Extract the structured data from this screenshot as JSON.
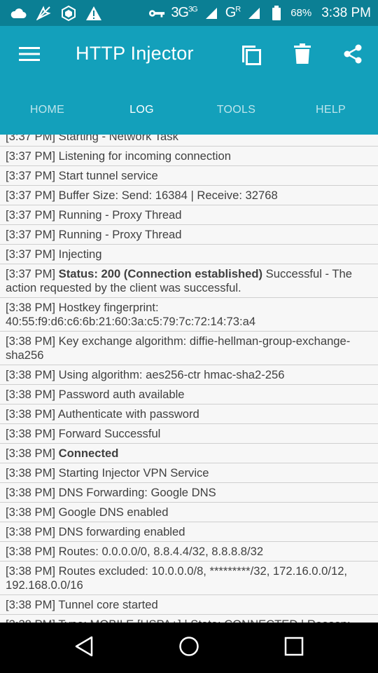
{
  "status_bar": {
    "network": "3G",
    "network_sup": "3G",
    "network2": "G",
    "network2_sup": "R",
    "battery": "68%",
    "time": "3:38 PM",
    "icons": [
      "cloud-icon",
      "no-location-icon",
      "shield-cube-icon",
      "warning-icon",
      "key-icon",
      "battery-icon"
    ]
  },
  "app_bar": {
    "title": "HTTP Injector",
    "icons": [
      "menu-icon",
      "copy-icon",
      "delete-icon",
      "share-icon"
    ]
  },
  "tabs": [
    {
      "label": "HOME",
      "active": false
    },
    {
      "label": "LOG",
      "active": true
    },
    {
      "label": "TOOLS",
      "active": false
    },
    {
      "label": "HELP",
      "active": false
    }
  ],
  "log": [
    {
      "time": "[3:37 PM]",
      "bold": "",
      "text": "Starting - Network Task"
    },
    {
      "time": "[3:37 PM]",
      "bold": "",
      "text": "Listening for incoming connection"
    },
    {
      "time": "[3:37 PM]",
      "bold": "",
      "text": "Start tunnel service"
    },
    {
      "time": "[3:37 PM]",
      "bold": "",
      "text": "Buffer Size: Send: 16384 | Receive: 32768"
    },
    {
      "time": "[3:37 PM]",
      "bold": "",
      "text": "Running - Proxy Thread"
    },
    {
      "time": "[3:37 PM]",
      "bold": "",
      "text": "Running - Proxy Thread"
    },
    {
      "time": "[3:37 PM]",
      "bold": "",
      "text": "Injecting"
    },
    {
      "time": "[3:37 PM]",
      "bold": "Status: 200 (Connection established)",
      "text": "Successful - The action requested by the client was successful."
    },
    {
      "time": "[3:38 PM]",
      "bold": "",
      "text": "Hostkey fingerprint: 40:55:f9:d6:c6:6b:21:60:3a:c5:79:7c:72:14:73:a4"
    },
    {
      "time": "[3:38 PM]",
      "bold": "",
      "text": "Key exchange algorithm: diffie-hellman-group-exchange-sha256"
    },
    {
      "time": "[3:38 PM]",
      "bold": "",
      "text": "Using algorithm: aes256-ctr hmac-sha2-256"
    },
    {
      "time": "[3:38 PM]",
      "bold": "",
      "text": "Password auth available"
    },
    {
      "time": "[3:38 PM]",
      "bold": "",
      "text": "Authenticate with password"
    },
    {
      "time": "[3:38 PM]",
      "bold": "",
      "text": "Forward Successful"
    },
    {
      "time": "[3:38 PM]",
      "bold": "Connected",
      "text": ""
    },
    {
      "time": "[3:38 PM]",
      "bold": "",
      "text": "Starting Injector VPN Service"
    },
    {
      "time": "[3:38 PM]",
      "bold": "",
      "text": "DNS Forwarding: Google DNS"
    },
    {
      "time": "[3:38 PM]",
      "bold": "",
      "text": "Google DNS enabled"
    },
    {
      "time": "[3:38 PM]",
      "bold": "",
      "text": "DNS forwarding enabled"
    },
    {
      "time": "[3:38 PM]",
      "bold": "",
      "text": "Routes: 0.0.0.0/0, 8.8.4.4/32, 8.8.8.8/32"
    },
    {
      "time": "[3:38 PM]",
      "bold": "",
      "text": "Routes excluded: 10.0.0.0/8, *********/32, 172.16.0.0/12, 192.168.0.0/16"
    },
    {
      "time": "[3:38 PM]",
      "bold": "",
      "text": "Tunnel core started"
    },
    {
      "time": "[3:38 PM]",
      "bold": "",
      "text": "Type: MOBILE [HSPA+] | State: CONNECTED | Reason: connected | internet"
    }
  ],
  "nav_bar": {
    "icons": [
      "back-icon",
      "home-icon",
      "recents-icon"
    ]
  },
  "colors": {
    "status_bar": "#0b7f94",
    "app_bar": "#13a0bb",
    "log_background": "#f7f7f7",
    "log_text": "#404040",
    "divider": "#cfcfcf"
  }
}
